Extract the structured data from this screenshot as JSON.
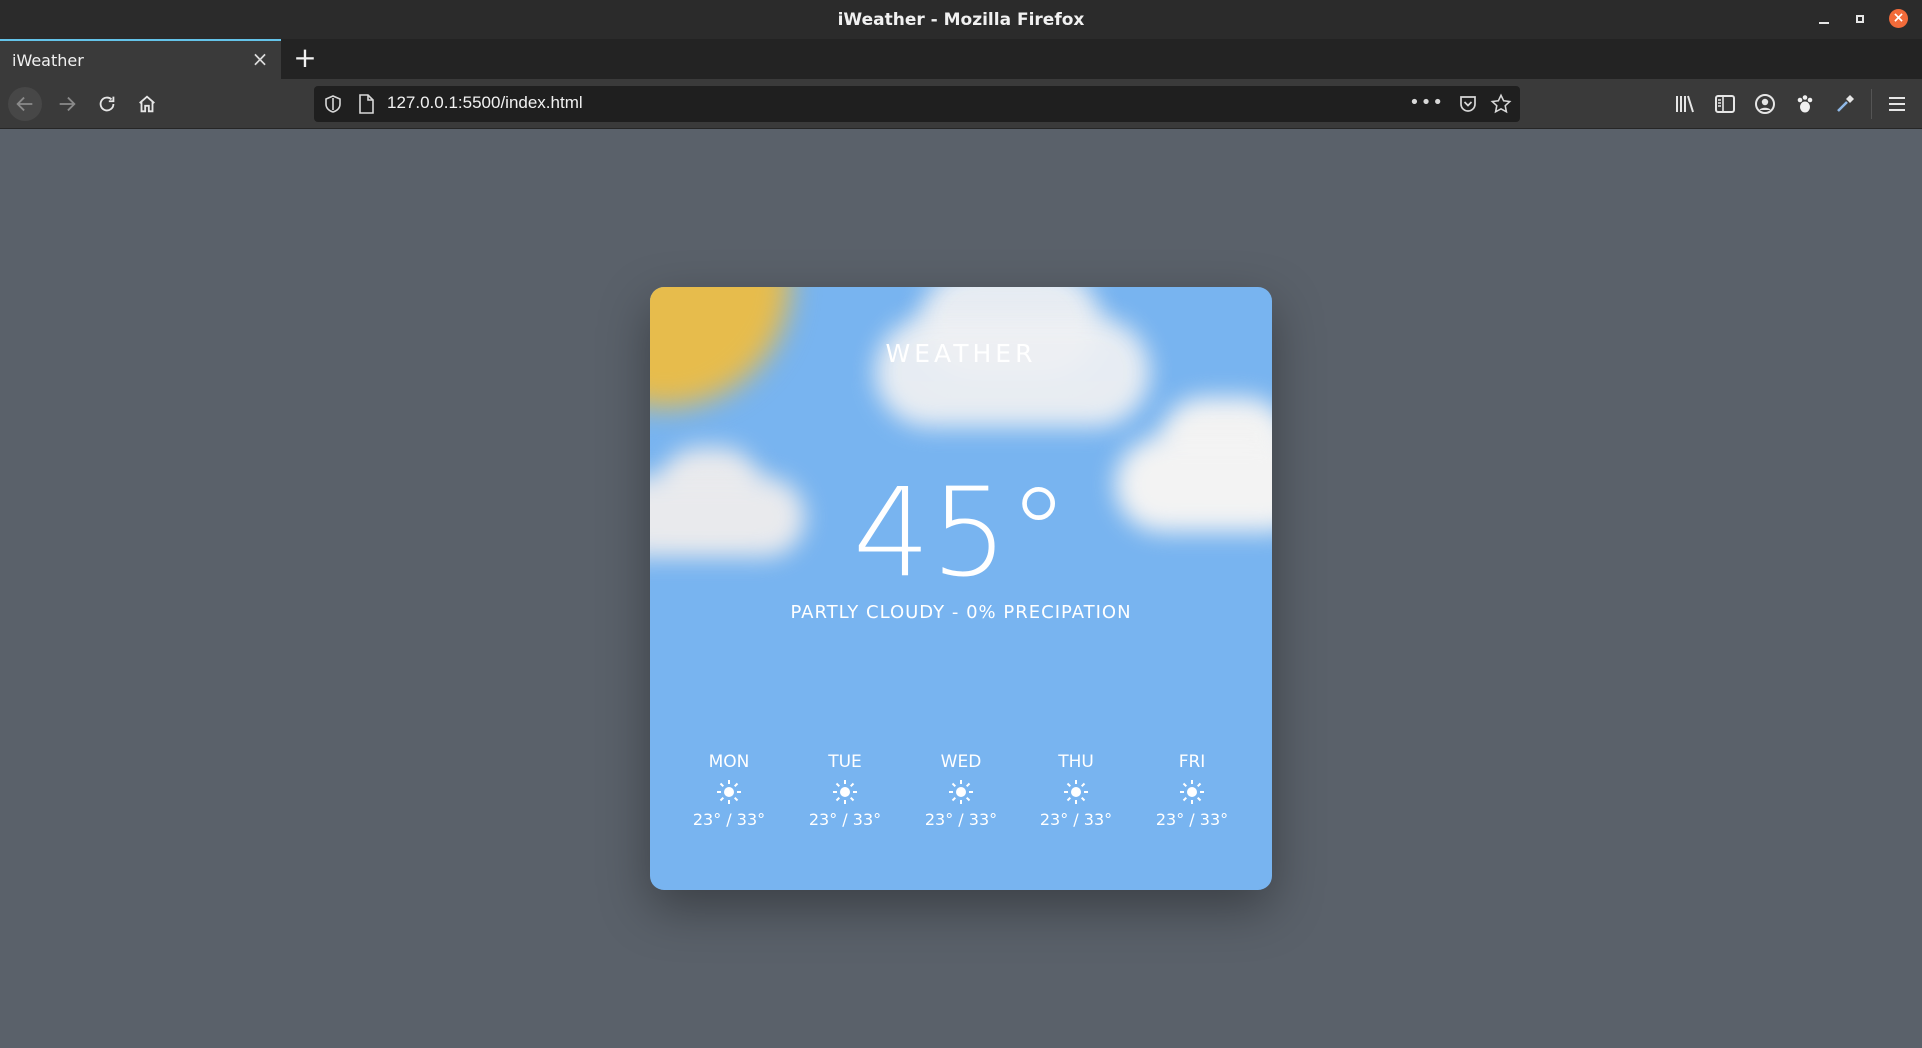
{
  "window": {
    "title": "iWeather - Mozilla Firefox"
  },
  "tab": {
    "label": "iWeather"
  },
  "navbar": {
    "url": "127.0.0.1:5500/index.html",
    "more": "•••"
  },
  "page": {
    "title": "WEATHER",
    "temperature": "45°",
    "condition": "PARTLY CLOUDY - 0% PRECIPATION",
    "forecast": [
      {
        "day": "MON",
        "icon": "sun-icon",
        "range": "23° / 33°"
      },
      {
        "day": "TUE",
        "icon": "sun-icon",
        "range": "23° / 33°"
      },
      {
        "day": "WED",
        "icon": "sun-icon",
        "range": "23° / 33°"
      },
      {
        "day": "THU",
        "icon": "sun-icon",
        "range": "23° / 33°"
      },
      {
        "day": "FRI",
        "icon": "sun-icon",
        "range": "23° / 33°"
      }
    ]
  },
  "colors": {
    "page_bg": "#5a616a",
    "card_bg": "#78b4f0",
    "sun": "#e7bc4c",
    "close_button": "#f26b3a",
    "tab_accent": "#64c3e9"
  }
}
